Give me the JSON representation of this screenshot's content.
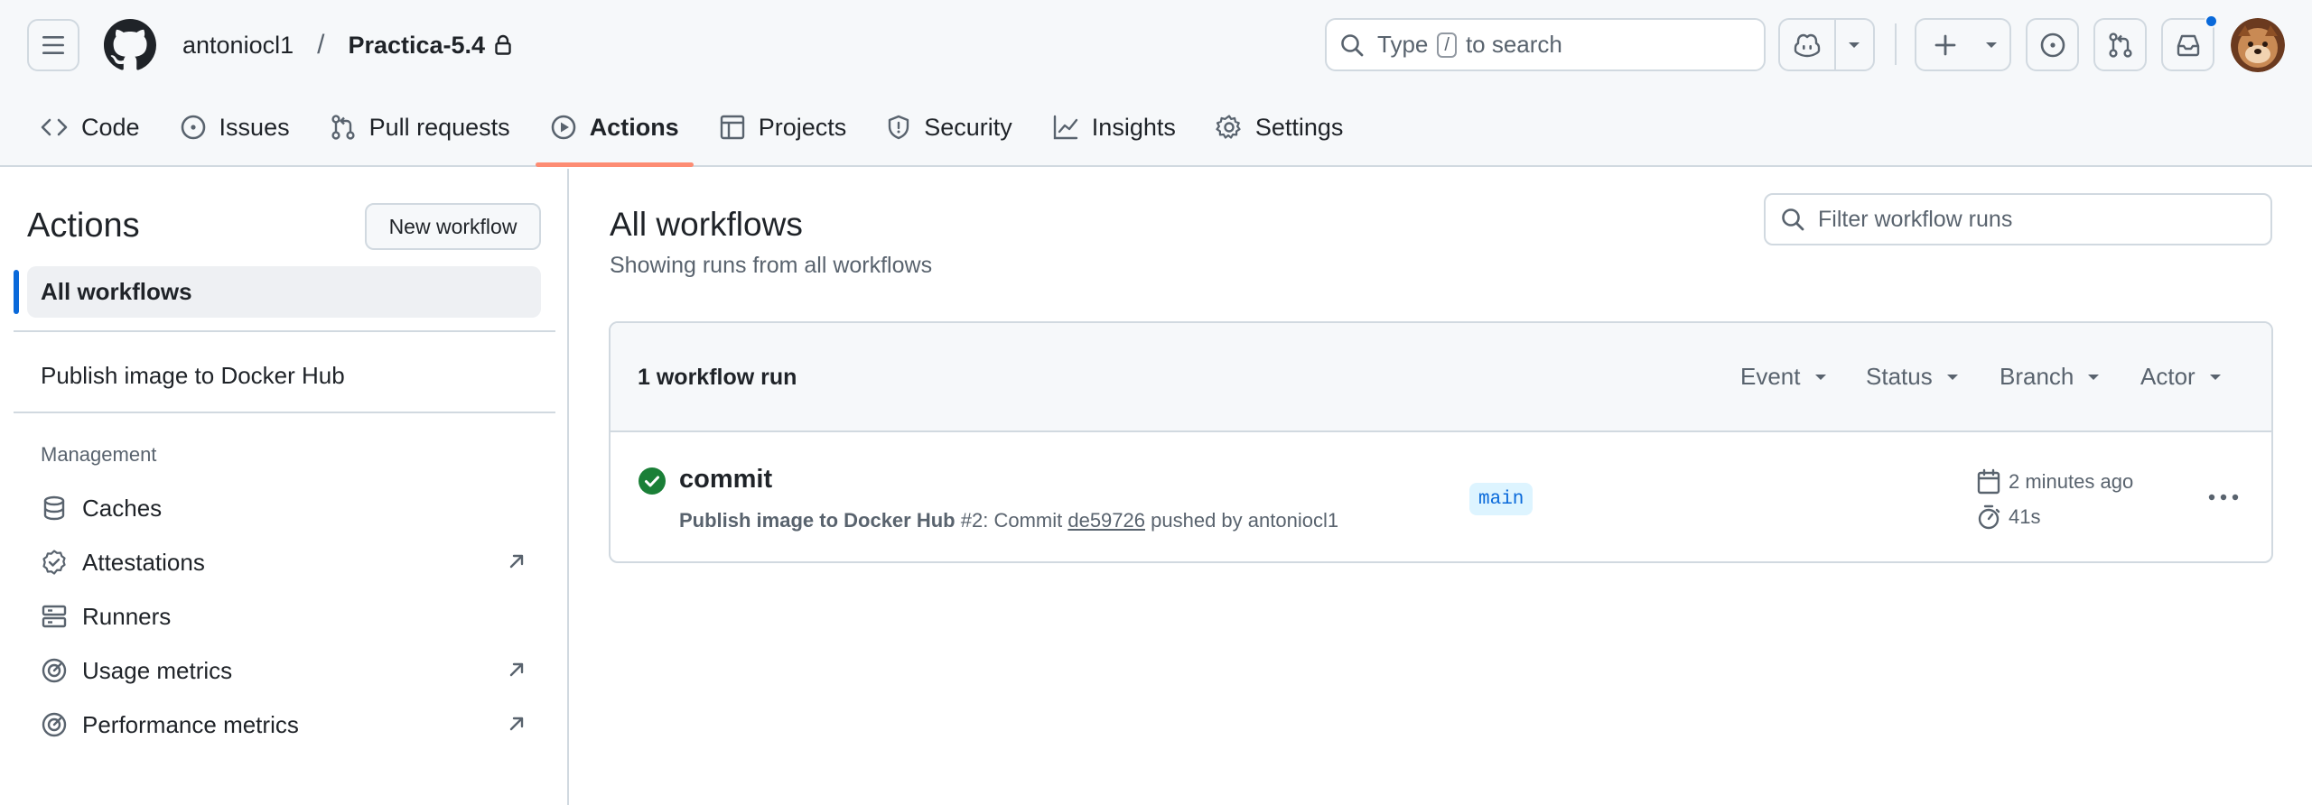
{
  "header": {
    "owner": "antoniocl1",
    "separator": "/",
    "repo": "Practica-5.4",
    "search": {
      "prefix": "Type",
      "key": "/",
      "suffix": "to search"
    },
    "icons": [
      "hamburger-icon",
      "github-logo",
      "lock-icon",
      "search-icon",
      "copilot-icon",
      "chevron-down-icon",
      "plus-icon",
      "issue-icon",
      "pull-request-icon",
      "inbox-icon",
      "avatar"
    ]
  },
  "tabs": [
    {
      "label": "Code",
      "icon": "code-icon"
    },
    {
      "label": "Issues",
      "icon": "issue-icon"
    },
    {
      "label": "Pull requests",
      "icon": "pull-request-icon"
    },
    {
      "label": "Actions",
      "icon": "play-icon",
      "active": true
    },
    {
      "label": "Projects",
      "icon": "table-icon"
    },
    {
      "label": "Security",
      "icon": "shield-icon"
    },
    {
      "label": "Insights",
      "icon": "graph-icon"
    },
    {
      "label": "Settings",
      "icon": "gear-icon"
    }
  ],
  "sidebar": {
    "title": "Actions",
    "new_workflow_label": "New workflow",
    "all_workflows_label": "All workflows",
    "workflows": [
      "Publish image to Docker Hub"
    ],
    "management_label": "Management",
    "management_items": [
      {
        "label": "Caches",
        "icon": "database-icon",
        "external": false
      },
      {
        "label": "Attestations",
        "icon": "verified-icon",
        "external": true
      },
      {
        "label": "Runners",
        "icon": "server-icon",
        "external": false
      },
      {
        "label": "Usage metrics",
        "icon": "meter-icon",
        "external": true
      },
      {
        "label": "Performance metrics",
        "icon": "meter-icon",
        "external": true
      }
    ]
  },
  "main": {
    "title": "All workflows",
    "subtitle": "Showing runs from all workflows",
    "filter_placeholder": "Filter workflow runs",
    "runs_count_label": "1 workflow run",
    "filters": [
      "Event",
      "Status",
      "Branch",
      "Actor"
    ],
    "runs": [
      {
        "name": "commit",
        "workflow": "Publish image to Docker Hub",
        "run_number": "#2",
        "meta_middle": ": Commit",
        "sha": "de59726",
        "meta_tail": "pushed by antoniocl1",
        "branch": "main",
        "when": "2 minutes ago",
        "duration": "41s",
        "status": "success"
      }
    ]
  },
  "colors": {
    "accent": "#0969da",
    "active_tab_underline": "#fd8c73",
    "success": "#1a7f37",
    "branch_bg": "#ddf4ff",
    "header_bg": "#f6f8fa",
    "border": "#d1d9e0"
  }
}
